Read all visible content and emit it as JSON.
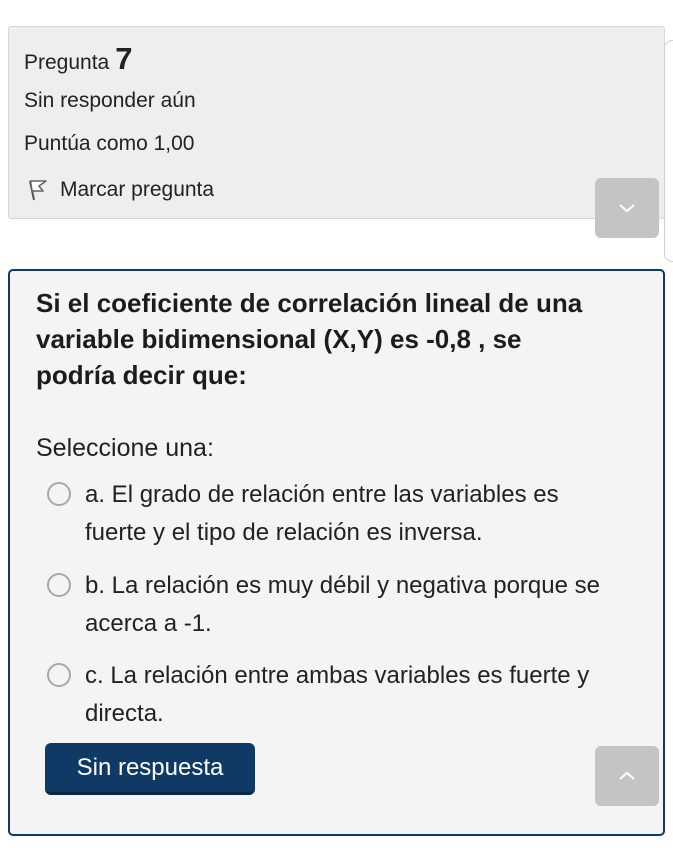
{
  "question_info": {
    "label": "Pregunta",
    "number": "7",
    "status": "Sin responder aún",
    "score": "Puntúa como 1,00",
    "flag_label": "Marcar pregunta"
  },
  "question": {
    "text": "Si el coeficiente de correlación lineal de una variable bidimensional (X,Y) es  -0,8 , se podría decir que:",
    "prompt": "Seleccione una:",
    "options": [
      {
        "label": "a. El grado de relación entre las variables es fuerte y el tipo de relación es inversa."
      },
      {
        "label": "b. La relación es muy débil y negativa porque se acerca a -1."
      },
      {
        "label": "c. La relación entre ambas variables es fuerte y directa."
      }
    ],
    "clear_button": "Sin respuesta"
  },
  "icons": {
    "flag": "flag-icon",
    "expand": "chevron-down-icon",
    "scroll_top": "chevron-up-icon"
  },
  "colors": {
    "accent": "#0f3a66",
    "info_background": "#eeeeee",
    "card_background": "#f4f4f5",
    "gray_button": "#c4c4c4"
  }
}
